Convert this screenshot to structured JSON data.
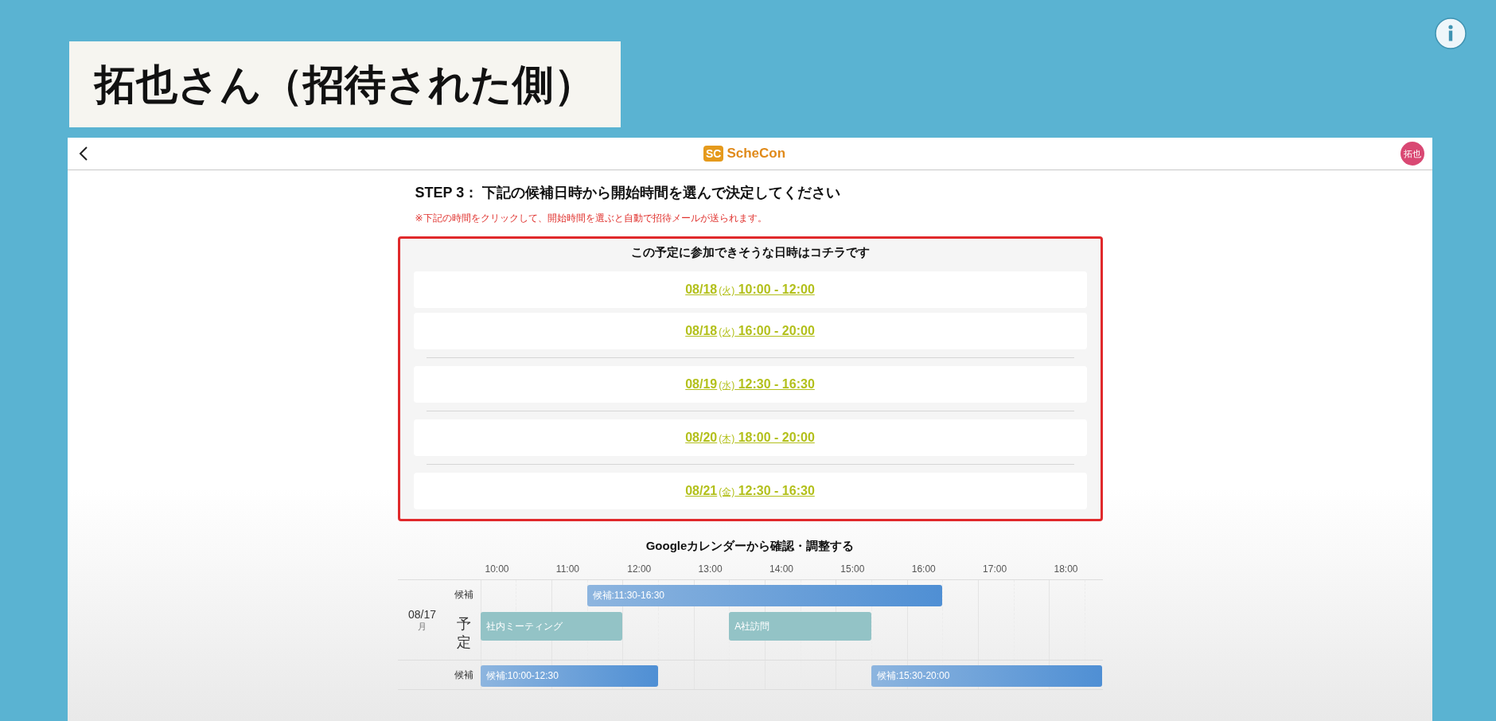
{
  "caption": "拓也さん（招待された側）",
  "topbar": {
    "logo_mark": "SC",
    "logo_name": "ScheCon",
    "avatar": "拓也"
  },
  "step_title": "STEP 3： 下記の候補日時から開始時間を選んで決定してください",
  "note": "※下記の時間をクリックして、開始時間を選ぶと自動で招待メールが送られます。",
  "candidates": {
    "title": "この予定に参加できそうな日時はコチラです",
    "days": [
      {
        "slots": [
          {
            "date": "08/18",
            "weekday": "(火)",
            "time": "10:00 - 12:00"
          },
          {
            "date": "08/18",
            "weekday": "(火)",
            "time": "16:00 - 20:00"
          }
        ]
      },
      {
        "slots": [
          {
            "date": "08/19",
            "weekday": "(水)",
            "time": "12:30 - 16:30"
          }
        ]
      },
      {
        "slots": [
          {
            "date": "08/20",
            "weekday": "(木)",
            "time": "18:00 - 20:00"
          }
        ]
      },
      {
        "slots": [
          {
            "date": "08/21",
            "weekday": "(金)",
            "time": "12:30 - 16:30"
          }
        ]
      }
    ]
  },
  "calendar": {
    "title": "Googleカレンダーから確認・調整する",
    "hours": [
      "10:00",
      "11:00",
      "12:00",
      "13:00",
      "14:00",
      "15:00",
      "16:00",
      "17:00",
      "18:00"
    ],
    "days": [
      {
        "date": "08/17",
        "weekday": "月",
        "rows": [
          {
            "kind": "candidate",
            "label": "候補",
            "events": [
              {
                "text": "候補:11:30-16:30"
              }
            ]
          },
          {
            "kind": "plan",
            "label": "予定",
            "events": [
              {
                "text": "社内ミーティング"
              },
              {
                "text": "A社訪問"
              }
            ]
          }
        ]
      },
      {
        "rows": [
          {
            "kind": "candidate",
            "label": "候補",
            "events": [
              {
                "text": "候補:10:00-12:30"
              },
              {
                "text": "候補:15:30-20:00"
              }
            ]
          }
        ]
      }
    ]
  }
}
